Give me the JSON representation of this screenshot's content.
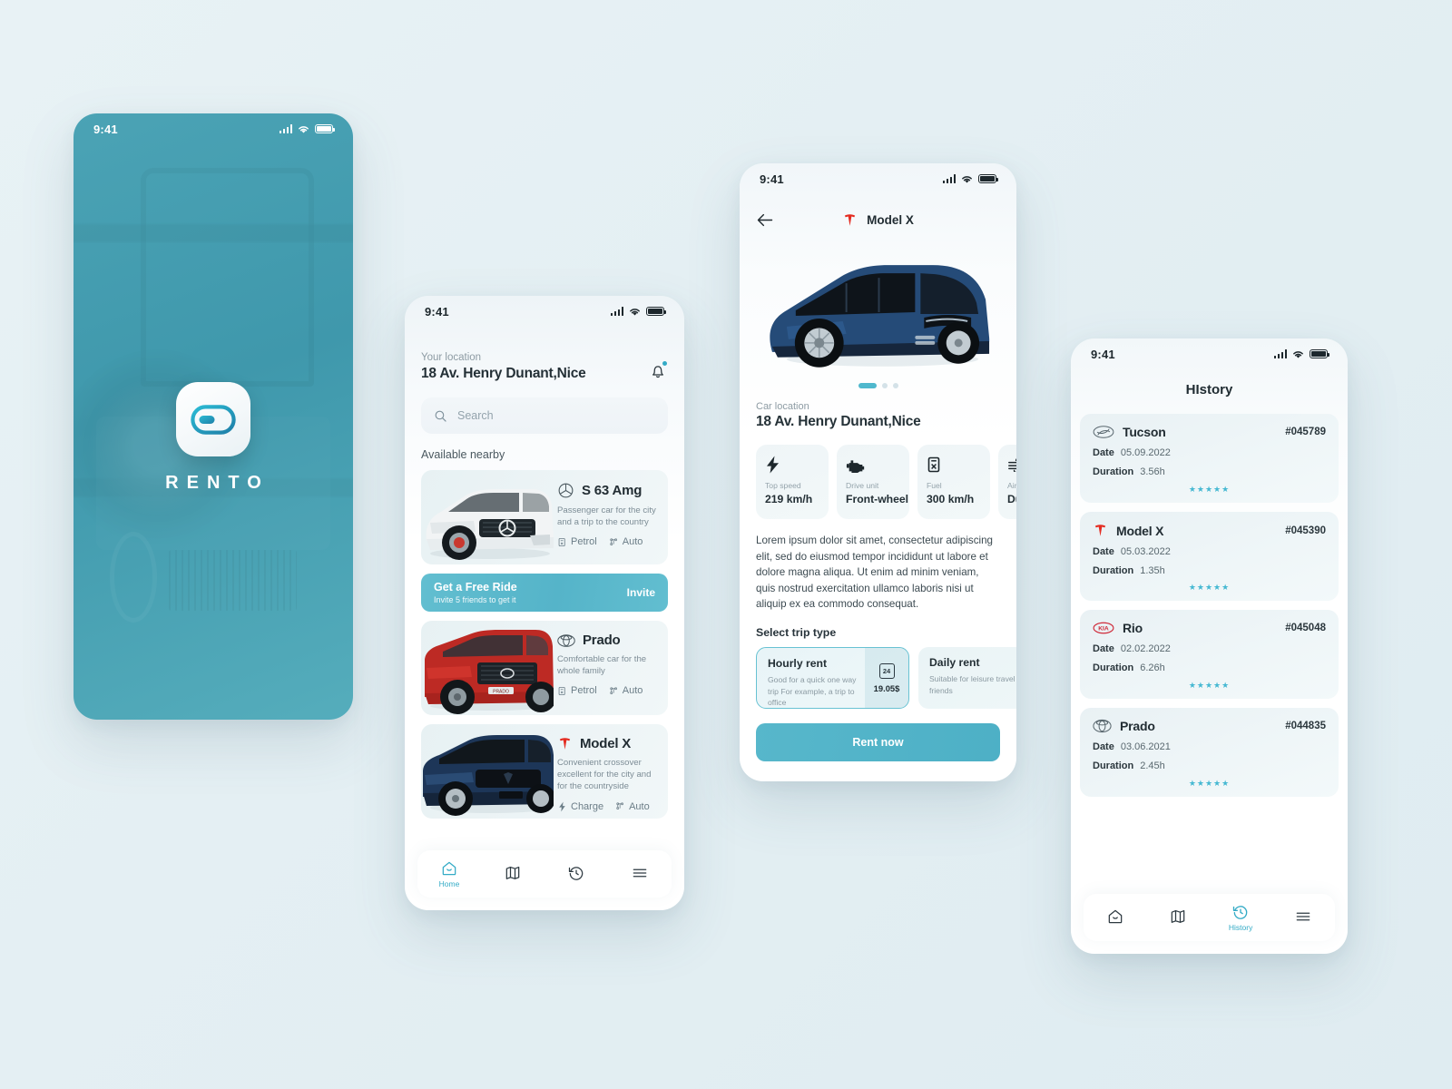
{
  "theme": {
    "accent": "#4fb8cd",
    "splash_bg": "#4ba3b5",
    "star": "#45b8d2",
    "tesla_red": "#e42b20",
    "kia_red": "#cf2b3a"
  },
  "statusbar": {
    "time": "9:41"
  },
  "splash": {
    "brand": "RENTO",
    "logo_icon": "rento-toggle-logo"
  },
  "home": {
    "location_label": "Your location",
    "location_value": "18 Av. Henry Dunant,Nice",
    "bell_icon": "notification-bell-icon",
    "search_placeholder": "Search",
    "search_value": "",
    "search_icon": "search-icon",
    "section_title": "Available nearby",
    "cars": [
      {
        "brand_icon": "mercedes-logo-icon",
        "name": "S 63 Amg",
        "desc": "Passenger car for the city and a trip to the country",
        "tags": [
          {
            "icon": "fuel-petrol-icon",
            "label": "Petrol"
          },
          {
            "icon": "gearbox-auto-icon",
            "label": "Auto"
          }
        ]
      },
      {
        "brand_icon": "toyota-logo-icon",
        "name": "Prado",
        "desc": "Comfortable car for the whole family",
        "tags": [
          {
            "icon": "fuel-petrol-icon",
            "label": "Petrol"
          },
          {
            "icon": "gearbox-auto-icon",
            "label": "Auto"
          }
        ]
      },
      {
        "brand_icon": "tesla-logo-icon",
        "name": "Model X",
        "desc": "Convenient crossover excellent for the city and for the countryside",
        "tags": [
          {
            "icon": "charge-bolt-icon",
            "label": "Charge"
          },
          {
            "icon": "gearbox-auto-icon",
            "label": "Auto"
          }
        ]
      }
    ],
    "promo": {
      "title": "Get a Free Ride",
      "subtitle": "Invite 5 friends to get it",
      "cta": "Invite"
    },
    "tabs": [
      {
        "icon": "home-icon",
        "label": "Home",
        "active": true
      },
      {
        "icon": "map-icon",
        "label": "",
        "active": false
      },
      {
        "icon": "history-clock-icon",
        "label": "",
        "active": false
      },
      {
        "icon": "menu-icon",
        "label": "",
        "active": false
      }
    ]
  },
  "detail": {
    "back_icon": "back-arrow-icon",
    "brand_icon": "tesla-logo-icon",
    "title": "Model X",
    "carousel": {
      "total": 3,
      "active": 1
    },
    "location_label": "Car location",
    "location_value": "18 Av. Henry Dunant,Nice",
    "specs": [
      {
        "icon": "bolt-icon",
        "label": "Top speed",
        "value": "219 km/h"
      },
      {
        "icon": "engine-icon",
        "label": "Drive unit",
        "value": "Front-wheel"
      },
      {
        "icon": "fuel-can-icon",
        "label": "Fuel",
        "value": "300 km/h"
      },
      {
        "icon": "air-wind-icon",
        "label": "Air",
        "value": "Dual"
      }
    ],
    "description": "Lorem ipsum dolor sit amet, consectetur adipiscing elit, sed do eiusmod tempor incididunt ut labore et dolore magna aliqua. Ut enim ad minim veniam, quis nostrud exercitation ullamco laboris nisi ut aliquip ex ea commodo consequat.",
    "trip_title": "Select trip type",
    "trips": [
      {
        "name": "Hourly rent",
        "desc": "Good for a quick one way trip For example, a trip to office",
        "price": "19.05$",
        "price_icon": "24h-calendar-icon",
        "selected": true
      },
      {
        "name": "Daily rent",
        "desc": "Suitable for leisure travel with family and friends",
        "price": "",
        "price_icon": "",
        "selected": false
      }
    ],
    "rent_button": "Rent now"
  },
  "history": {
    "title": "HIstory",
    "labels": {
      "date": "Date",
      "duration": "Duration"
    },
    "rows": [
      {
        "brand_icon": "hyundai-logo-icon",
        "name": "Tucson",
        "order": "#045789",
        "date": "05.09.2022",
        "duration": "3.56h",
        "rating": 5,
        "stars": "★★★★★"
      },
      {
        "brand_icon": "tesla-logo-icon",
        "name": "Model X",
        "order": "#045390",
        "date": "05.03.2022",
        "duration": "1.35h",
        "rating": 5,
        "stars": "★★★★★"
      },
      {
        "brand_icon": "kia-logo-icon",
        "name": "Rio",
        "order": "#045048",
        "date": "02.02.2022",
        "duration": "6.26h",
        "rating": 5,
        "stars": "★★★★★"
      },
      {
        "brand_icon": "toyota-logo-icon",
        "name": "Prado",
        "order": "#044835",
        "date": "03.06.2021",
        "duration": "2.45h",
        "rating": 5,
        "stars": "★★★★★"
      }
    ],
    "tabs": [
      {
        "icon": "home-icon",
        "label": "",
        "active": false
      },
      {
        "icon": "map-icon",
        "label": "",
        "active": false
      },
      {
        "icon": "history-clock-icon",
        "label": "History",
        "active": true
      },
      {
        "icon": "menu-icon",
        "label": "",
        "active": false
      }
    ]
  }
}
